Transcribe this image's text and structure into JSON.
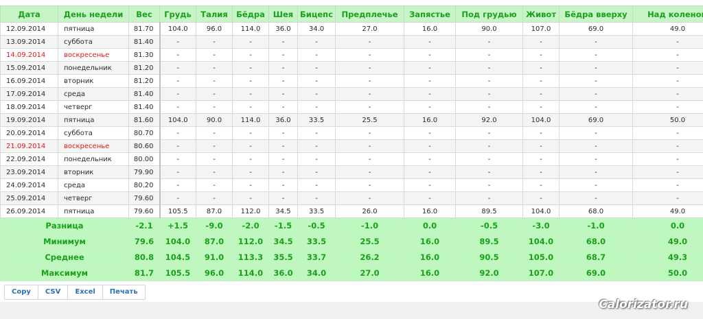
{
  "table": {
    "headers": [
      "Дата",
      "День недели",
      "Вес",
      "Грудь",
      "Талия",
      "Бёдра",
      "Шея",
      "Бицепс",
      "Предплечье",
      "Запястье",
      "Под грудью",
      "Живот",
      "Бёдра вверху",
      "Над коленом"
    ],
    "rows": [
      {
        "weekend": false,
        "cells": [
          "12.09.2014",
          "пятница",
          "81.70",
          "104.0",
          "96.0",
          "114.0",
          "36.0",
          "34.0",
          "27.0",
          "16.0",
          "90.0",
          "107.0",
          "69.0",
          "49.0"
        ]
      },
      {
        "weekend": false,
        "cells": [
          "13.09.2014",
          "суббота",
          "81.40",
          "-",
          "-",
          "-",
          "-",
          "-",
          "-",
          "-",
          "-",
          "-",
          "-",
          "-"
        ]
      },
      {
        "weekend": true,
        "cells": [
          "14.09.2014",
          "воскресенье",
          "81.30",
          "-",
          "-",
          "-",
          "-",
          "-",
          "-",
          "-",
          "-",
          "-",
          "-",
          "-"
        ]
      },
      {
        "weekend": false,
        "cells": [
          "15.09.2014",
          "понедельник",
          "81.20",
          "-",
          "-",
          "-",
          "-",
          "-",
          "-",
          "-",
          "-",
          "-",
          "-",
          "-"
        ]
      },
      {
        "weekend": false,
        "cells": [
          "16.09.2014",
          "вторник",
          "81.20",
          "-",
          "-",
          "-",
          "-",
          "-",
          "-",
          "-",
          "-",
          "-",
          "-",
          "-"
        ]
      },
      {
        "weekend": false,
        "cells": [
          "17.09.2014",
          "среда",
          "81.40",
          "-",
          "-",
          "-",
          "-",
          "-",
          "-",
          "-",
          "-",
          "-",
          "-",
          "-"
        ]
      },
      {
        "weekend": false,
        "cells": [
          "18.09.2014",
          "четверг",
          "81.40",
          "-",
          "-",
          "-",
          "-",
          "-",
          "-",
          "-",
          "-",
          "-",
          "-",
          "-"
        ]
      },
      {
        "weekend": false,
        "cells": [
          "19.09.2014",
          "пятница",
          "81.60",
          "104.0",
          "90.0",
          "114.0",
          "36.0",
          "33.5",
          "25.5",
          "16.0",
          "92.0",
          "104.0",
          "69.0",
          "50.0"
        ]
      },
      {
        "weekend": false,
        "cells": [
          "20.09.2014",
          "суббота",
          "80.70",
          "-",
          "-",
          "-",
          "-",
          "-",
          "-",
          "-",
          "-",
          "-",
          "-",
          "-"
        ]
      },
      {
        "weekend": true,
        "cells": [
          "21.09.2014",
          "воскресенье",
          "80.60",
          "-",
          "-",
          "-",
          "-",
          "-",
          "-",
          "-",
          "-",
          "-",
          "-",
          "-"
        ]
      },
      {
        "weekend": false,
        "cells": [
          "22.09.2014",
          "понедельник",
          "80.00",
          "-",
          "-",
          "-",
          "-",
          "-",
          "-",
          "-",
          "-",
          "-",
          "-",
          "-"
        ]
      },
      {
        "weekend": false,
        "cells": [
          "23.09.2014",
          "вторник",
          "79.90",
          "-",
          "-",
          "-",
          "-",
          "-",
          "-",
          "-",
          "-",
          "-",
          "-",
          "-"
        ]
      },
      {
        "weekend": false,
        "cells": [
          "24.09.2014",
          "среда",
          "80.20",
          "-",
          "-",
          "-",
          "-",
          "-",
          "-",
          "-",
          "-",
          "-",
          "-",
          "-"
        ]
      },
      {
        "weekend": false,
        "cells": [
          "25.09.2014",
          "четверг",
          "79.60",
          "-",
          "-",
          "-",
          "-",
          "-",
          "-",
          "-",
          "-",
          "-",
          "-",
          "-"
        ]
      },
      {
        "weekend": false,
        "cells": [
          "26.09.2014",
          "пятница",
          "79.60",
          "105.5",
          "87.0",
          "112.0",
          "34.5",
          "33.5",
          "26.0",
          "16.0",
          "89.5",
          "104.0",
          "68.0",
          "49.0"
        ]
      }
    ],
    "summary": [
      {
        "label": "Разница",
        "values": [
          "-2.1",
          "+1.5",
          "-9.0",
          "-2.0",
          "-1.5",
          "-0.5",
          "-1.0",
          "0.0",
          "-0.5",
          "-3.0",
          "-1.0",
          "0.0"
        ]
      },
      {
        "label": "Минимум",
        "values": [
          "79.6",
          "104.0",
          "87.0",
          "112.0",
          "34.5",
          "33.5",
          "25.5",
          "16.0",
          "89.5",
          "104.0",
          "68.0",
          "49.0"
        ]
      },
      {
        "label": "Среднее",
        "values": [
          "80.8",
          "104.5",
          "91.0",
          "113.3",
          "35.5",
          "33.7",
          "26.2",
          "16.0",
          "90.5",
          "105.0",
          "68.7",
          "49.3"
        ]
      },
      {
        "label": "Максимум",
        "values": [
          "81.7",
          "105.5",
          "96.0",
          "114.0",
          "36.0",
          "34.0",
          "27.0",
          "16.0",
          "92.0",
          "107.0",
          "69.0",
          "50.0"
        ]
      }
    ]
  },
  "toolbar": {
    "buttons": [
      "Copy",
      "CSV",
      "Excel",
      "Печать"
    ]
  },
  "watermark": "Calorizator.ru",
  "colors": {
    "header_bg": "#c8f5c8",
    "header_text": "#1aa01a",
    "summary_bg": "#bff8bf",
    "weekend_text": "#e01818",
    "button_text": "#2a6fb3"
  }
}
